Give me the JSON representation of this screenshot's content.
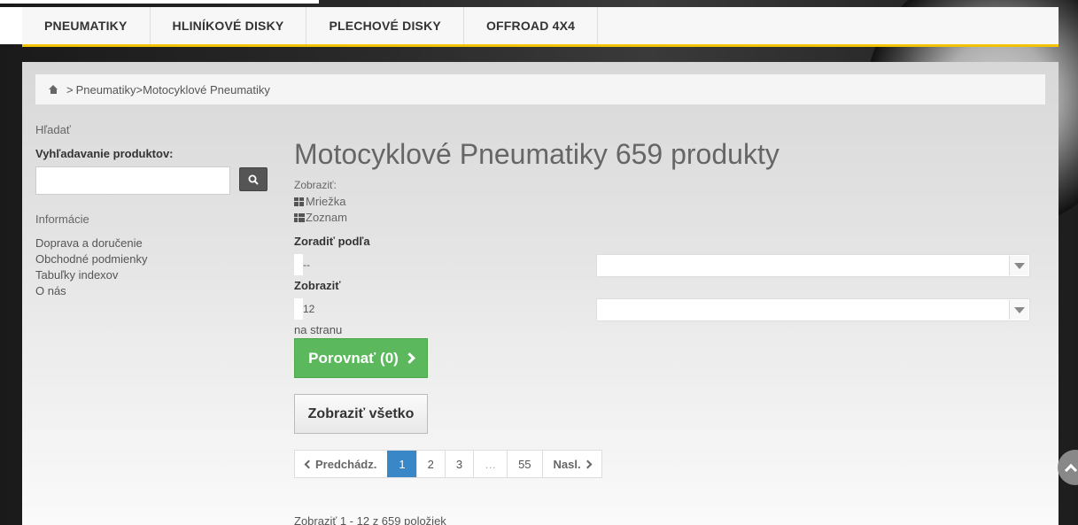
{
  "nav": {
    "items": [
      {
        "label": "PNEUMATIKY"
      },
      {
        "label": "HLINÍKOVÉ DISKY"
      },
      {
        "label": "PLECHOVÉ DISKY"
      },
      {
        "label": "OFFROAD 4X4"
      }
    ]
  },
  "breadcrumb": {
    "separator": ">",
    "level1": "Pneumatiky",
    "level2": ">Motocyklové Pneumatiky"
  },
  "sidebar": {
    "search_title": "Hľadať",
    "search_label": "Vyhľadavanie produktov:",
    "search_value": "",
    "info_title": "Informácie",
    "links": [
      {
        "label": "Doprava a doručenie"
      },
      {
        "label": "Obchodné podmienky"
      },
      {
        "label": "Tabuľky indexov"
      },
      {
        "label": "O nás"
      }
    ]
  },
  "content": {
    "title": "Motocyklové Pneumatiky 659 produkty",
    "view_label": "Zobraziť:",
    "view_grid": "Mriežka",
    "view_list": "Zoznam",
    "sort_label": "Zoradiť podľa",
    "sort_value": "--",
    "per_page_label": "Zobraziť",
    "per_page_value": "12",
    "per_page_suffix": "na stranu",
    "compare_label": "Porovnať (0)",
    "show_all_label": "Zobraziť všetko",
    "count_text": "Zobraziť 1 - 12 z 659 položiek"
  },
  "pagination": {
    "prev": "Predchádz.",
    "pages": [
      "1",
      "2",
      "3",
      "…",
      "55"
    ],
    "current": "1",
    "next": "Nasl."
  },
  "colors": {
    "accent": "#f2c100",
    "compare_button": "#5cb85c",
    "active_page": "#3a87c8"
  },
  "icons": [
    "home-icon",
    "search-icon",
    "grid-icon",
    "list-icon",
    "chevron-right-icon",
    "chevron-left-icon",
    "arrow-up-icon"
  ]
}
